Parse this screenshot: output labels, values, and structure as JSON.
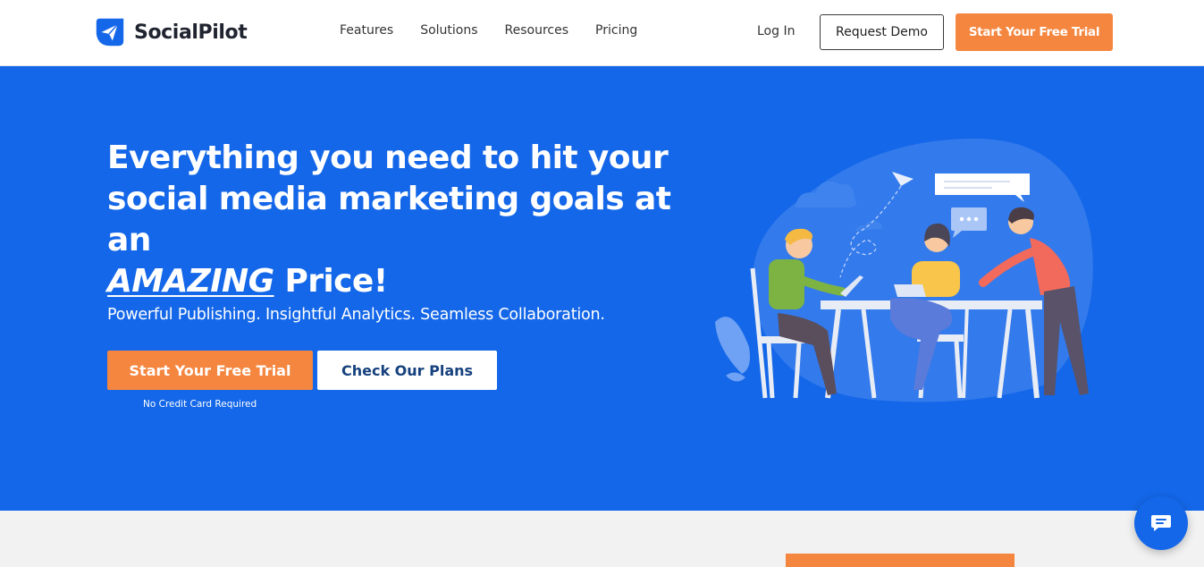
{
  "brand": {
    "name": "SocialPilot",
    "logo_icon": "paper-plane-icon",
    "color": "#1467e8"
  },
  "nav": {
    "items": [
      {
        "label": "Features"
      },
      {
        "label": "Solutions"
      },
      {
        "label": "Resources"
      },
      {
        "label": "Pricing"
      }
    ],
    "login_label": "Log In",
    "demo_label": "Request Demo",
    "trial_label": "Start Your Free Trial"
  },
  "hero": {
    "headline_line1": "Everything you need to hit your",
    "headline_line2": "social media marketing goals at an",
    "headline_emphasis": "AMAZING",
    "headline_end": " Price!",
    "subline": "Powerful Publishing. Insightful Analytics. Seamless Collaboration.",
    "cta_primary": "Start Your Free Trial",
    "cta_secondary": "Check Our Plans",
    "note": "No Credit Card Required"
  },
  "chat": {
    "icon": "chat-icon"
  },
  "colors": {
    "accent": "#f5863f",
    "hero_bg": "#1467e8"
  }
}
